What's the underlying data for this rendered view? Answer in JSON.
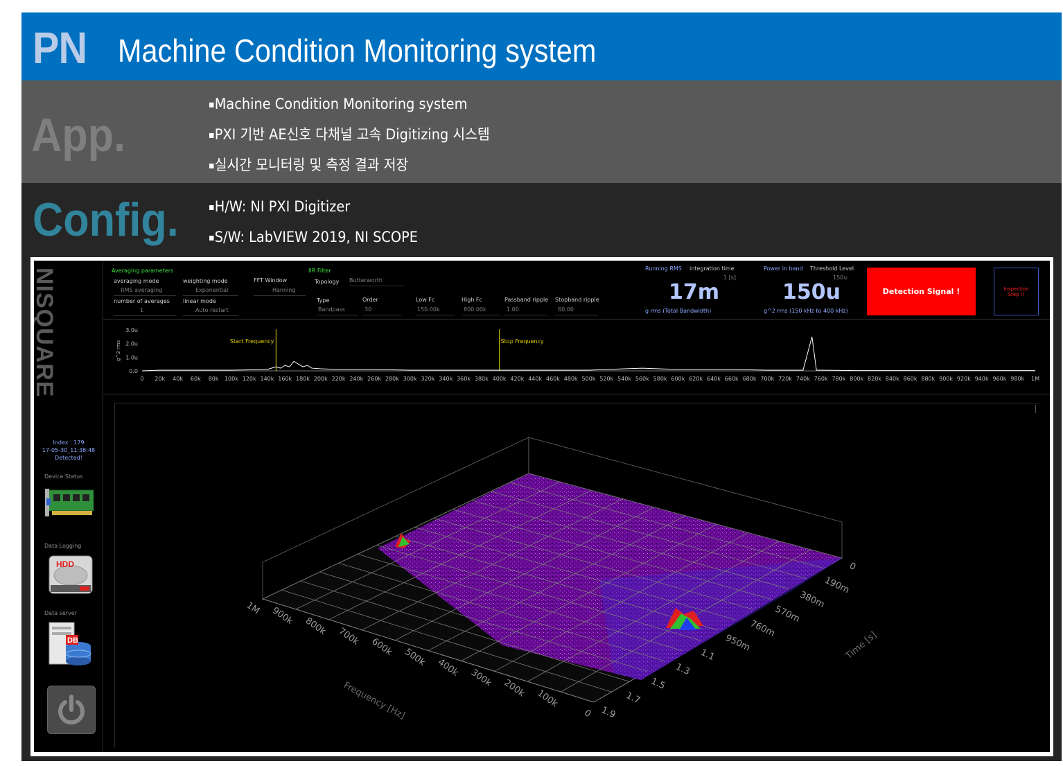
{
  "banner": {
    "logo": "PN",
    "title": "Machine Condition Monitoring system"
  },
  "app": {
    "label": "App.",
    "bullets": [
      "Machine Condition Monitoring system",
      "PXI 기반 AE신호 다채널 고속 Digitizing 시스템",
      "실시간 모니터링 및 측정 결과 저장"
    ]
  },
  "config": {
    "label": "Config.",
    "bullets": [
      "H/W: NI PXI Digitizer",
      "S/W: LabVIEW 2019, NI SCOPE"
    ]
  },
  "screen": {
    "brand": "NISQUARE",
    "averaging": {
      "title": "Averaging parameters",
      "averaging_mode_label": "averaging mode",
      "averaging_mode_value": "RMS averaging",
      "weighting_mode_label": "weighting mode",
      "weighting_mode_value": "Exponential",
      "num_averages_label": "number of averages",
      "num_averages_value": "1",
      "linear_mode_label": "linear mode",
      "linear_mode_value": "Auto restart"
    },
    "fft": {
      "label": "FFT Window",
      "value": "Hanning"
    },
    "iir": {
      "title": "IIR Filter",
      "topology_label": "Topology",
      "topology_value": "Butterworth",
      "type_label": "Type",
      "type_value": "Bandpass",
      "order_label": "Order",
      "order_value": "30",
      "low_fc_label": "Low Fc",
      "low_fc_value": "150.00k",
      "high_fc_label": "High Fc",
      "high_fc_value": "800.00k",
      "passband_label": "Passband ripple",
      "passband_value": "1.00",
      "stopband_label": "Stopband ripple",
      "stopband_value": "60.00"
    },
    "rms": {
      "label": "Running RMS",
      "integration_label": "integration time",
      "integration_value": "1 [s]",
      "value": "17m",
      "unit": "g rms (Total Bandwidth)"
    },
    "power": {
      "label": "Power in band",
      "threshold_label": "Threshold Level",
      "threshold_value": "150u",
      "value": "150u",
      "unit": "g^2 rms (150 kHz to 400 kHz)"
    },
    "detect_button": "Detection Signal !",
    "stop_button": "Inspection Stop !!",
    "status": {
      "index": "Index : 179",
      "timestamp": "17-05-30_11:38:48",
      "state": "Detected!"
    },
    "device_status_label": "Device Status",
    "data_logging_label": "Data Logging",
    "hdd_label": "HDD",
    "data_server_label": "Data server",
    "db_label": "DB",
    "colors": {
      "accent_green": "#3fe03f",
      "label_blue": "#8ea8ff",
      "alarm_red": "#ff0000",
      "surface_purple": "#b020d8"
    }
  },
  "surface_plot": {
    "frequency_axis_label": "Frequency [Hz]",
    "frequency_ticks": [
      "0",
      "100k",
      "200k",
      "300k",
      "400k",
      "500k",
      "600k",
      "700k",
      "800k",
      "900k",
      "1M"
    ],
    "time_axis_label": "Time [s]",
    "time_ticks": [
      "0",
      "190m",
      "380m",
      "570m",
      "760m",
      "950m",
      "1.1",
      "1.3",
      "1.5",
      "1.7",
      "1.9"
    ]
  },
  "chart_data": {
    "type": "line",
    "title": "",
    "xlabel": "",
    "ylabel": "g^2 rms",
    "ylim": [
      0,
      3.0
    ],
    "yticks": [
      "0.0",
      "1.0u",
      "2.0u",
      "3.0u"
    ],
    "xticks": [
      "0",
      "20k",
      "40k",
      "60k",
      "80k",
      "100k",
      "120k",
      "140k",
      "160k",
      "180k",
      "200k",
      "220k",
      "240k",
      "260k",
      "280k",
      "300k",
      "320k",
      "340k",
      "360k",
      "380k",
      "400k",
      "420k",
      "440k",
      "460k",
      "480k",
      "500k",
      "520k",
      "540k",
      "560k",
      "580k",
      "600k",
      "620k",
      "640k",
      "660k",
      "680k",
      "700k",
      "720k",
      "740k",
      "760k",
      "780k",
      "800k",
      "820k",
      "840k",
      "860k",
      "880k",
      "900k",
      "920k",
      "940k",
      "960k",
      "980k",
      "1M"
    ],
    "markers": [
      {
        "name": "Start Frequency",
        "x": 150000
      },
      {
        "name": "Stop Frequency",
        "x": 400000
      }
    ],
    "series": [
      {
        "x": [
          0,
          20000,
          100000,
          140000,
          150000,
          155000,
          160000,
          165000,
          170000,
          175000,
          180000,
          185000,
          190000,
          200000,
          220000,
          260000,
          300000,
          400000,
          500000,
          540000,
          560000,
          600000,
          660000,
          700000,
          740000,
          750000,
          755000,
          760000,
          800000,
          1000000
        ],
        "values": [
          0,
          0.05,
          0.05,
          0.1,
          0.3,
          0.2,
          0.4,
          0.3,
          0.7,
          0.5,
          0.3,
          0.4,
          0.2,
          0.15,
          0.1,
          0.1,
          0.05,
          0.05,
          0.05,
          0.15,
          0.2,
          0.1,
          0.1,
          0.05,
          0.05,
          2.5,
          0.05,
          0.05,
          0.02,
          0.02
        ]
      }
    ]
  }
}
